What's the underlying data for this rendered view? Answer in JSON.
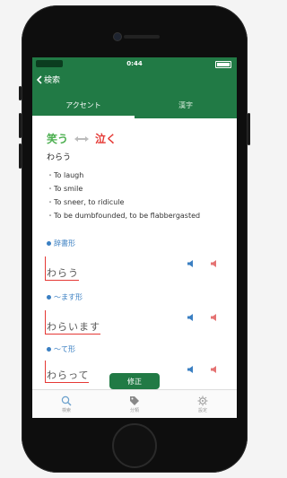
{
  "status": {
    "time": "0:44"
  },
  "nav": {
    "back_label": "検索"
  },
  "tabs": [
    {
      "label": "アクセント",
      "active": true
    },
    {
      "label": "漢字",
      "active": false
    }
  ],
  "word": {
    "main": "笑う",
    "opposite": "泣く",
    "reading": "わらう"
  },
  "meanings": [
    "To laugh",
    "To smile",
    "To sneer, to ridicule",
    "To be dumbfounded, to be flabbergasted"
  ],
  "sections": [
    {
      "title": "辞書形",
      "form": "わらう"
    },
    {
      "title": "〜ます形",
      "form": "わらいます"
    },
    {
      "title": "〜て形",
      "form": "わらって"
    }
  ],
  "fix_button": {
    "label": "修正"
  },
  "bottom_tabs": [
    {
      "label": "検索",
      "icon": "search-icon"
    },
    {
      "label": "分類",
      "icon": "tag-icon"
    },
    {
      "label": "設定",
      "icon": "gear-icon"
    }
  ],
  "colors": {
    "primary": "#217a45",
    "blue": "#3a7fc2",
    "red": "#e53935",
    "green_word": "#4caf50"
  }
}
